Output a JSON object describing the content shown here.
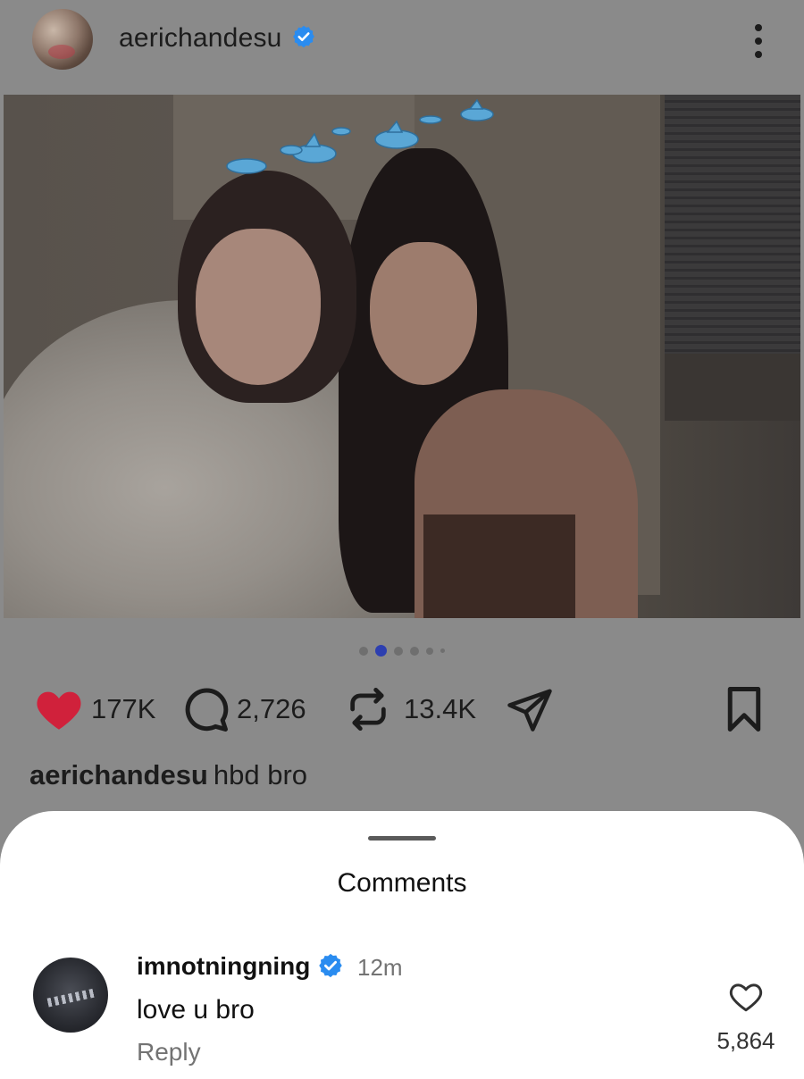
{
  "post": {
    "username": "aerichandesu",
    "verified": true,
    "avatar_icon": "profile-avatar",
    "more_icon": "vertical-ellipsis-icon"
  },
  "carousel": {
    "total_dots": 6,
    "active_index": 1
  },
  "actions": {
    "likes": "177K",
    "comments": "2,726",
    "reposts": "13.4K",
    "liked": true,
    "like_color": "#d0213b"
  },
  "caption": {
    "username": "aerichandesu",
    "text": "hbd bro"
  },
  "sheet": {
    "title": "Comments"
  },
  "comments": [
    {
      "username": "imnotningning",
      "verified": true,
      "time": "12m",
      "text": "love u bro",
      "reply_label": "Reply",
      "likes": "5,864"
    }
  ],
  "colors": {
    "verified_blue": "#2a8cf0",
    "overlay_gray": "#8a8a8a"
  }
}
